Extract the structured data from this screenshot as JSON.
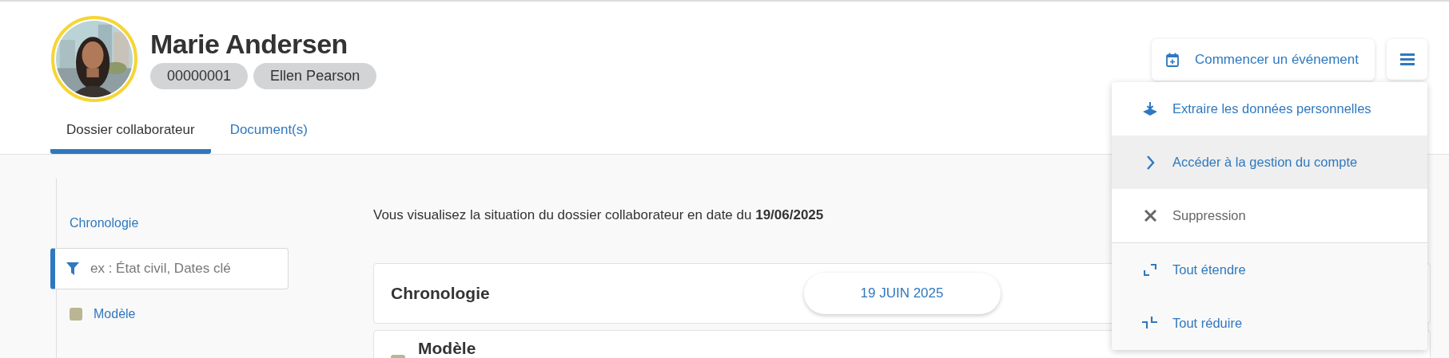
{
  "profile": {
    "name": "Marie Andersen",
    "badges": [
      "00000001",
      "Ellen Pearson"
    ]
  },
  "tabs": [
    {
      "label": "Dossier collaborateur",
      "selected": true
    },
    {
      "label": "Document(s)",
      "selected": false
    }
  ],
  "actions": {
    "start_event": "Commencer un événement"
  },
  "menu": {
    "groups": [
      [
        {
          "label": "Extraire les données personnelles",
          "disabled": false,
          "highlighted": false
        },
        {
          "label": "Accéder à la gestion du compte",
          "disabled": false,
          "highlighted": true
        },
        {
          "label": "Suppression",
          "disabled": true,
          "highlighted": false
        }
      ],
      [
        {
          "label": "Tout étendre",
          "disabled": false,
          "highlighted": false
        },
        {
          "label": "Tout réduire",
          "disabled": false,
          "highlighted": false
        }
      ]
    ]
  },
  "sidebar": {
    "link": "Chronologie",
    "filter": {
      "placeholder": "ex : État civil, Dates clé"
    },
    "items": [
      {
        "label": "Modèle",
        "color": "#bab592"
      }
    ]
  },
  "main": {
    "notice": "Vous visualisez la situation du dossier collaborateur en date du **19/06/2025**",
    "timeline": {
      "title": "Chronologie",
      "date": "19 JUIN 2025"
    },
    "sections": [
      {
        "title": "Modèle",
        "color": "#bab592"
      }
    ]
  }
}
